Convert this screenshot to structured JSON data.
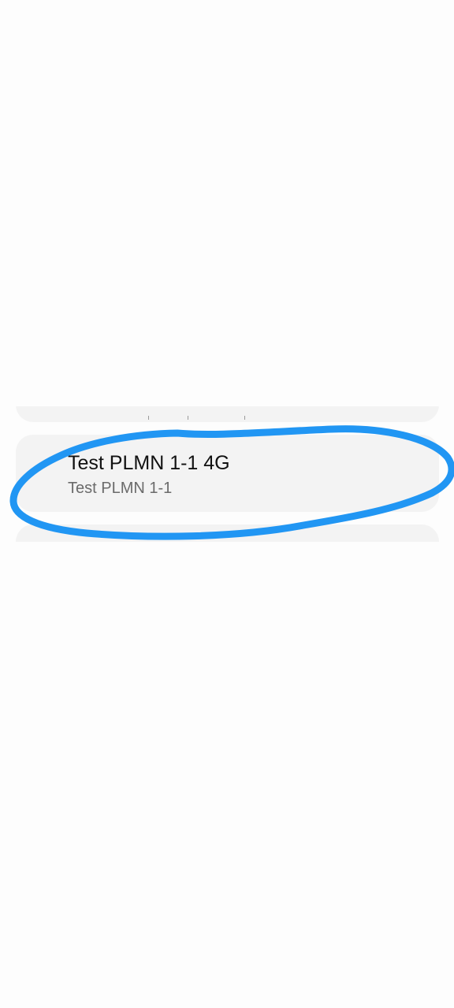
{
  "network_list": {
    "selected_item": {
      "title": "Test PLMN 1-1 4G",
      "subtitle": "Test PLMN 1-1"
    }
  },
  "annotation": {
    "color": "#2196f3"
  }
}
